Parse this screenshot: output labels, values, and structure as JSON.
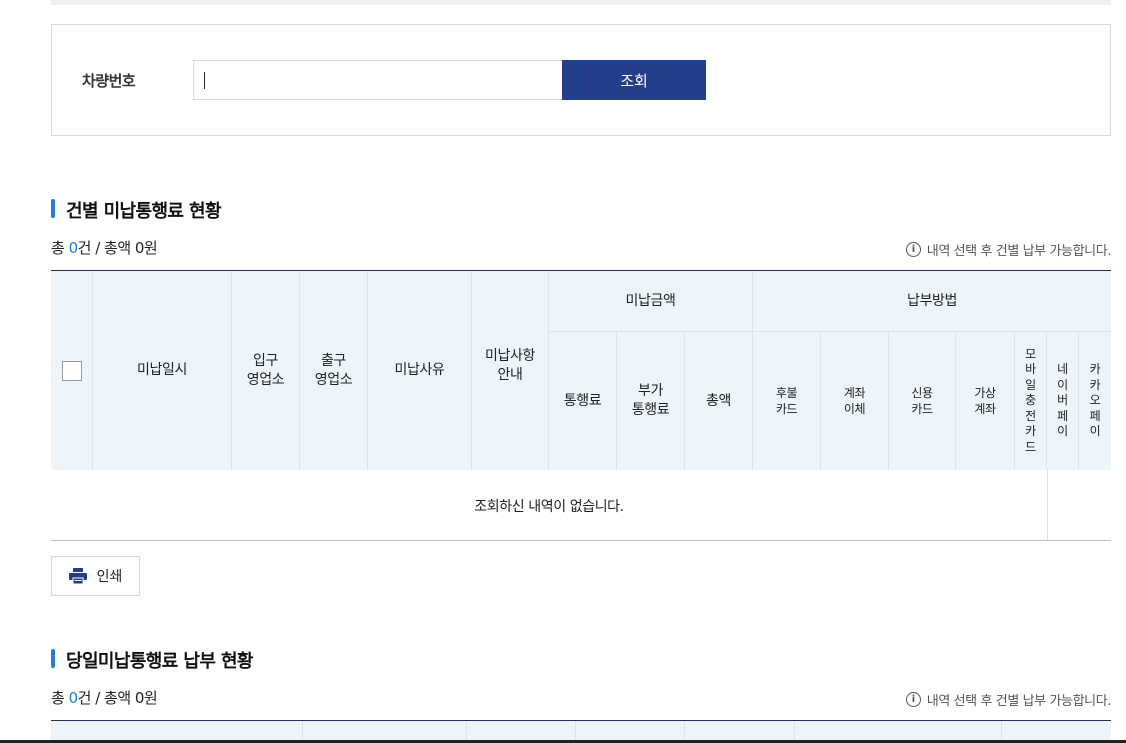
{
  "search": {
    "label": "차량번호",
    "input_value": "",
    "button_label": "조회"
  },
  "section1": {
    "title": "건별 미납통행료 현황",
    "summary_prefix": "총 ",
    "count": "0",
    "summary_mid": "건 / 총액 ",
    "amount": "0원",
    "notice": "내역 선택 후 건별 납부 가능합니다.",
    "table": {
      "headers": {
        "date": "미납일시",
        "entry_office": "입구\n영업소",
        "exit_office": "출구\n영업소",
        "reason": "미납사유",
        "guide": "미납사항\n안내",
        "unpaid_amount_group": "미납금액",
        "toll": "통행료",
        "extra_toll": "부가\n통행료",
        "total": "총액",
        "payment_method_group": "납부방법",
        "postpaid_card": "후불\n카드",
        "account_transfer": "계좌\n이체",
        "credit_card": "신용\n카드",
        "virtual_account": "가상\n계좌",
        "mobile_card": "모바일충전카드",
        "naver_pay": "네이버페이",
        "kakao_pay": "카카오페이"
      },
      "empty_message": "조회하신 내역이 없습니다."
    }
  },
  "print_button": {
    "label": "인쇄"
  },
  "section2": {
    "title": "당일미납통행료 납부 현황",
    "summary_prefix": "총 ",
    "count": "0",
    "summary_mid": "건 / 총액 ",
    "amount": "0원",
    "notice": "내역 선택 후 건별 납부 가능합니다."
  },
  "colors": {
    "primary_button": "#233e8b",
    "accent": "#1f7ed0",
    "header_bg": "#edf5fb"
  }
}
